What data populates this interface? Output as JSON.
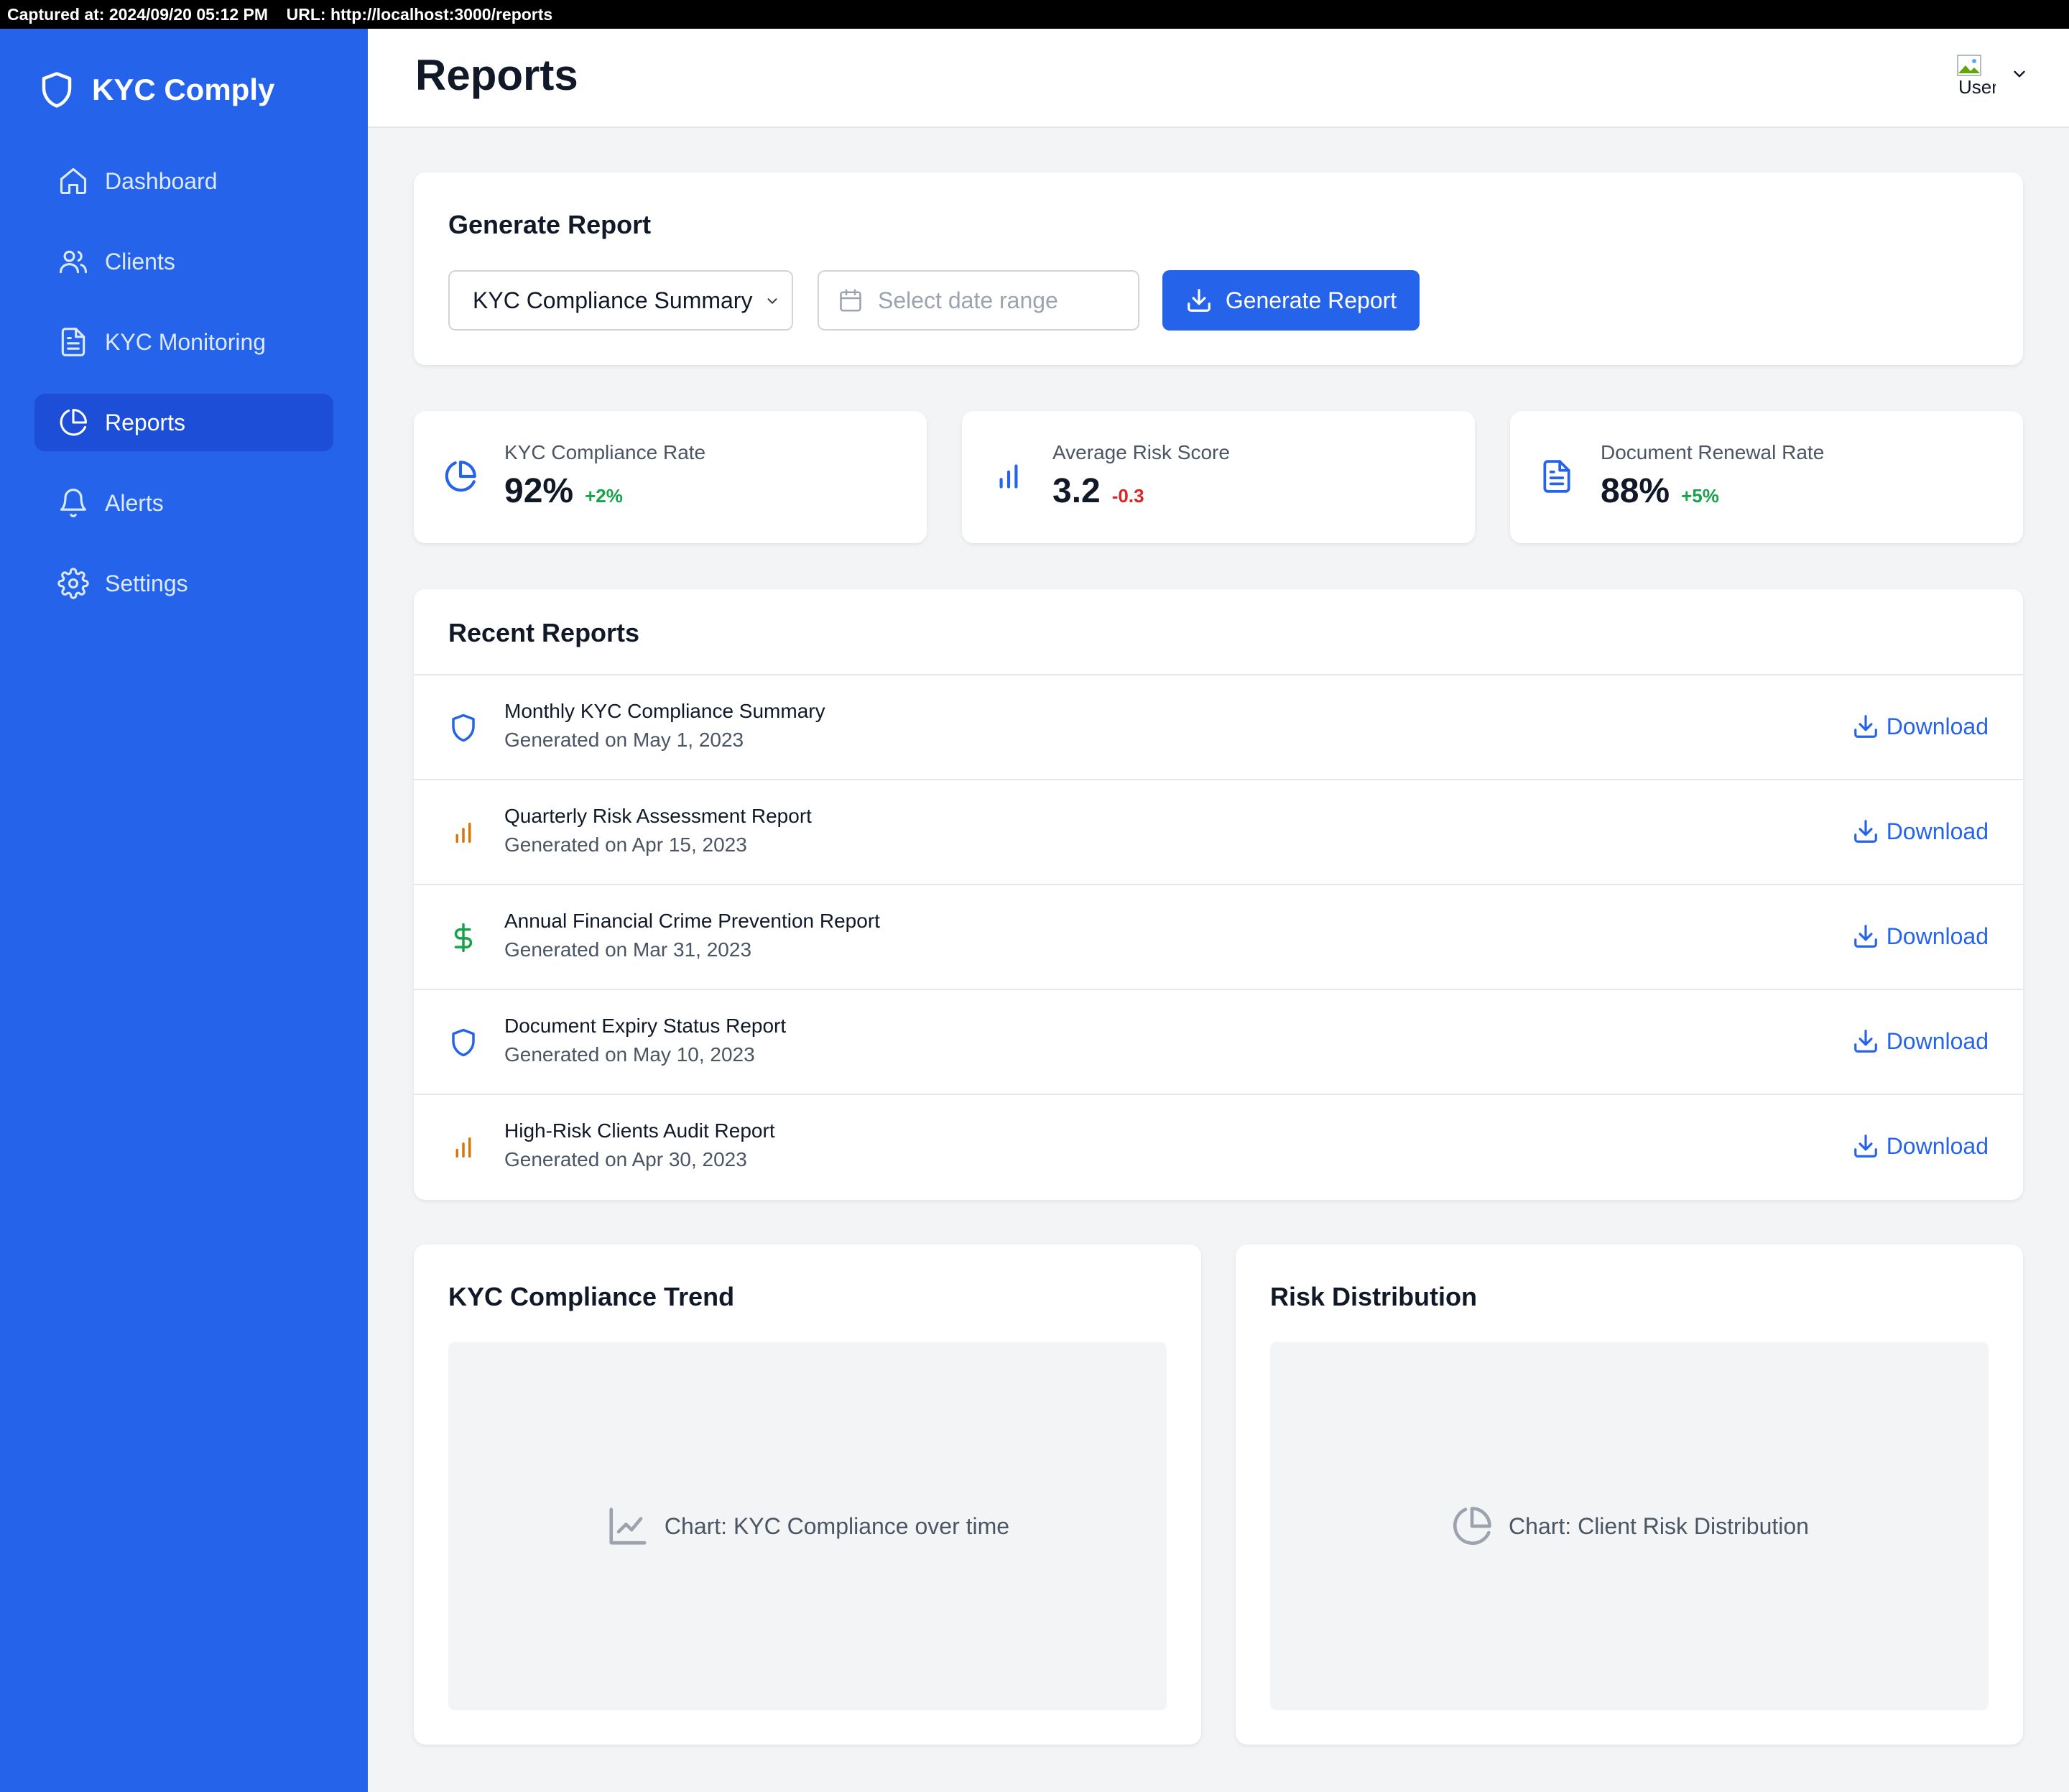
{
  "capture": {
    "text": "Captured at: 2024/09/20 05:12 PM    URL: http://localhost:3000/reports"
  },
  "brand": {
    "name": "KYC Comply",
    "icon": "shield-icon"
  },
  "nav": {
    "items": [
      {
        "label": "Dashboard",
        "icon": "home-icon",
        "active": false
      },
      {
        "label": "Clients",
        "icon": "users-icon",
        "active": false
      },
      {
        "label": "KYC Monitoring",
        "icon": "document-icon",
        "active": false
      },
      {
        "label": "Reports",
        "icon": "pie-chart-icon",
        "active": true
      },
      {
        "label": "Alerts",
        "icon": "bell-icon",
        "active": false
      },
      {
        "label": "Settings",
        "icon": "gear-icon",
        "active": false
      }
    ]
  },
  "header": {
    "title": "Reports",
    "user_alt": "User",
    "user_icon": "chevron-down-icon"
  },
  "generate": {
    "title": "Generate Report",
    "report_type": "KYC Compliance Summary",
    "date_placeholder": "Select date range",
    "button_label": "Generate Report"
  },
  "stats": [
    {
      "label": "KYC Compliance Rate",
      "value": "92%",
      "change": "+2%",
      "trend": "positive",
      "icon": "pie-chart-icon"
    },
    {
      "label": "Average Risk Score",
      "value": "3.2",
      "change": "-0.3",
      "trend": "negative",
      "icon": "bar-chart-icon"
    },
    {
      "label": "Document Renewal Rate",
      "value": "88%",
      "change": "+5%",
      "trend": "positive",
      "icon": "document-icon"
    }
  ],
  "recent": {
    "title": "Recent Reports",
    "download_label": "Download",
    "items": [
      {
        "name": "Monthly KYC Compliance Summary",
        "date": "Generated on May 1, 2023",
        "icon": "shield-icon",
        "color": "#2563eb"
      },
      {
        "name": "Quarterly Risk Assessment Report",
        "date": "Generated on Apr 15, 2023",
        "icon": "bar-chart-icon",
        "color": "#d97706"
      },
      {
        "name": "Annual Financial Crime Prevention Report",
        "date": "Generated on Mar 31, 2023",
        "icon": "dollar-icon",
        "color": "#16a34a"
      },
      {
        "name": "Document Expiry Status Report",
        "date": "Generated on May 10, 2023",
        "icon": "shield-icon",
        "color": "#2563eb"
      },
      {
        "name": "High-Risk Clients Audit Report",
        "date": "Generated on Apr 30, 2023",
        "icon": "bar-chart-icon",
        "color": "#d97706"
      }
    ]
  },
  "charts": {
    "trend": {
      "title": "KYC Compliance Trend",
      "placeholder": "Chart: KYC Compliance over time",
      "icon": "line-chart-icon"
    },
    "risk": {
      "title": "Risk Distribution",
      "placeholder": "Chart: Client Risk Distribution",
      "icon": "pie-chart-icon"
    }
  },
  "colors": {
    "primary": "#2563eb",
    "sidebar_active": "#1d4ed8",
    "positive": "#16a34a",
    "negative": "#dc2626",
    "amber": "#d97706"
  }
}
